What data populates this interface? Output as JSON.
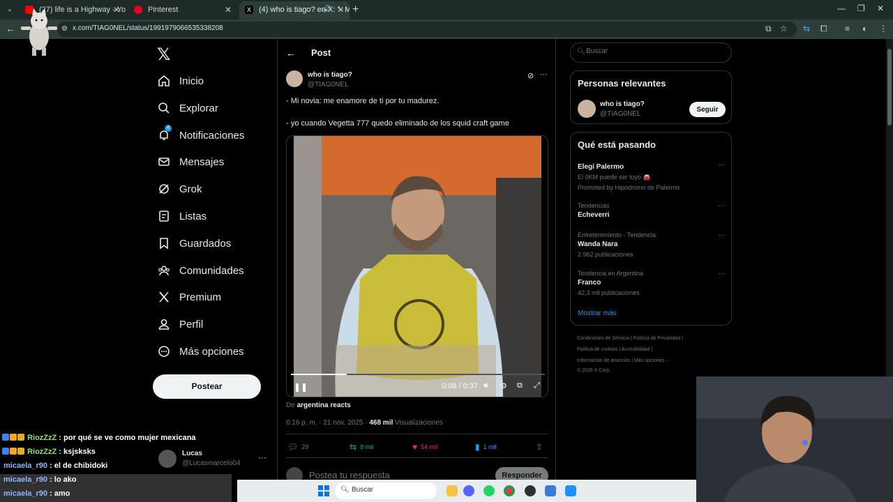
{
  "browser": {
    "tabs": [
      {
        "title": "(27) life is a Highway - YouTube",
        "favicon_color": "#ff0000"
      },
      {
        "title": "Pinterest",
        "favicon_color": "#e60023"
      },
      {
        "title": "(4) who is tiago? en X: \"- Mi",
        "favicon_color": "#000000"
      }
    ],
    "url": "x.com/TIAG0NEL/status/1991979066535338208"
  },
  "sidebar": {
    "items": [
      {
        "label": "Inicio",
        "icon": "home-icon"
      },
      {
        "label": "Explorar",
        "icon": "search-icon"
      },
      {
        "label": "Notificaciones",
        "icon": "bell-icon",
        "badge": "4"
      },
      {
        "label": "Mensajes",
        "icon": "mail-icon"
      },
      {
        "label": "Grok",
        "icon": "grok-icon"
      },
      {
        "label": "Listas",
        "icon": "list-icon"
      },
      {
        "label": "Guardados",
        "icon": "bookmark-icon"
      },
      {
        "label": "Comunidades",
        "icon": "people-icon"
      },
      {
        "label": "Premium",
        "icon": "x-icon"
      },
      {
        "label": "Perfil",
        "icon": "user-icon"
      },
      {
        "label": "Más opciones",
        "icon": "more-circle-icon"
      }
    ],
    "post_button": "Postear",
    "account": {
      "name": "Lucas",
      "handle": "@Lucasmarcelo04"
    }
  },
  "post": {
    "header_title": "Post",
    "author_name": "who is tiago?",
    "author_handle": "@TIAG0NEL",
    "text_line1": "- Mi novia: me enamore de ti por tu madurez.",
    "text_line2": "- yo cuando Vegetta 777 quedo eliminado de los squid craft game",
    "video": {
      "time": "0:08 / 0:37",
      "progress": 0.22
    },
    "from_prefix": "De",
    "from_source": "argentina reacts",
    "time": "6:16 p. m. · 21 nov. 2025 ·",
    "views_count": "468 mil",
    "views_label": "Visualizaciones",
    "actions": {
      "replies": "29",
      "reposts": "8 mil",
      "likes": "54 mil",
      "bookmarks": "1 mil"
    },
    "reply_placeholder": "Postea tu respuesta",
    "reply_button": "Responder"
  },
  "right": {
    "search_placeholder": "Buscar",
    "relevant_title": "Personas relevantes",
    "relevant_person": {
      "name": "who is tiago?",
      "handle": "@TIAG0NEL",
      "button": "Seguir"
    },
    "trends_title": "Qué está pasando",
    "trends": [
      {
        "context": "",
        "name": "Elegí Palermo",
        "sub": "El 0KM puede ser tuyo 🚘",
        "promo": "Promoted by Hipódromo de Palermo"
      },
      {
        "context": "Tendencias",
        "name": "Echeverri",
        "sub": ""
      },
      {
        "context": "Entretenimiento · Tendencia",
        "name": "Wanda Nara",
        "sub": "2.962 publicaciones"
      },
      {
        "context": "Tendencia en Argentina",
        "name": "Franco",
        "sub": "42,3 mil publicaciones"
      }
    ],
    "show_more": "Mostrar más",
    "footer": {
      "line1": "Condiciones de Servicio  |  Política de Privacidad  |",
      "line2": "Política de cookies  |  Accesibilidad  |",
      "line3": "Información de anuncios  |  Más opciones ···",
      "line4": "© 2025 X Corp."
    }
  },
  "chat": [
    {
      "user": "RiozZzZ",
      "msg": ": por qué se ve como mujer mexicana"
    },
    {
      "user": "RiozZzZ",
      "msg": ": ksjsksks"
    },
    {
      "user": "micaela_r90",
      "msg": ": el de chibidoki"
    },
    {
      "user": "micaela_r90",
      "msg": ": lo ako"
    },
    {
      "user": "micaela_r90",
      "msg": ": amo"
    }
  ],
  "taskbar": {
    "search_label": "Buscar"
  }
}
